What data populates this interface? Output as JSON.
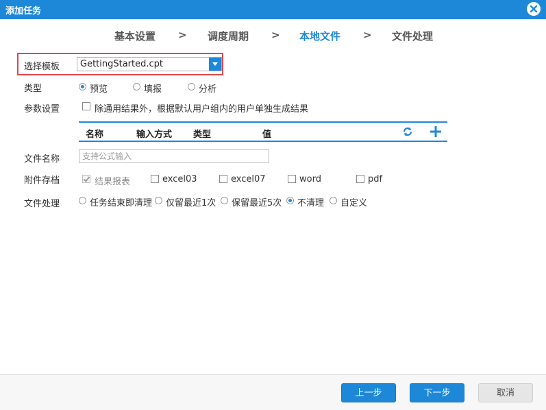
{
  "dialog": {
    "title": "添加任务"
  },
  "steps": [
    {
      "label": "基本设置",
      "active": false
    },
    {
      "label": "调度周期",
      "active": false
    },
    {
      "label": "本地文件",
      "active": true
    },
    {
      "label": "文件处理",
      "active": false
    }
  ],
  "step_separator": ">",
  "form": {
    "template_label": "选择模板",
    "template_value": "GettingStarted.cpt",
    "type_label": "类型",
    "type_options": [
      "预览",
      "填报",
      "分析"
    ],
    "type_selected": "预览",
    "params_label": "参数设置",
    "params_checkbox": "除通用结果外，根据默认用户组内的用户单独生成结果",
    "param_table_headers": [
      "名称",
      "输入方式",
      "类型",
      "值"
    ],
    "filename_label": "文件名称",
    "filename_placeholder": "支持公式输入",
    "attach_label": "附件存档",
    "attach_options": [
      {
        "label": "结果报表",
        "checked": true,
        "disabled": true
      },
      {
        "label": "excel03",
        "checked": false,
        "disabled": false
      },
      {
        "label": "excel07",
        "checked": false,
        "disabled": false
      },
      {
        "label": "word",
        "checked": false,
        "disabled": false
      },
      {
        "label": "pdf",
        "checked": false,
        "disabled": false
      }
    ],
    "fileproc_label": "文件处理",
    "fileproc_options": [
      "任务结束即清理",
      "仅留最近1次",
      "保留最近5次",
      "不清理",
      "自定义"
    ],
    "fileproc_selected": "不清理"
  },
  "footer": {
    "prev": "上一步",
    "next": "下一步",
    "cancel": "取消"
  },
  "colors": {
    "accent": "#1e88d8",
    "highlight_border": "#e0474c"
  }
}
